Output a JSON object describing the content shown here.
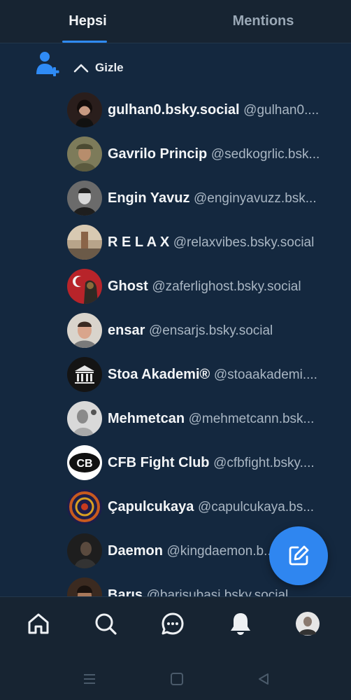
{
  "tabs": [
    {
      "label": "Hepsi",
      "active": true
    },
    {
      "label": "Mentions",
      "active": false
    }
  ],
  "toggle": {
    "label": "Gizle",
    "icon": "chevron-up-icon",
    "add_icon": "add-person-icon"
  },
  "users": [
    {
      "name": "gulhan0.bsky.social",
      "handle": "@gulhan0....",
      "avatar_color": "#3a2a26"
    },
    {
      "name": "Gavrilo Princip",
      "handle": "@sedkogrlic.bsk...",
      "avatar_color": "#6b6a4a"
    },
    {
      "name": "Engin Yavuz",
      "handle": "@enginyavuzz.bsk...",
      "avatar_color": "#555555"
    },
    {
      "name": "R E L A X",
      "handle": "@relaxvibes.bsky.social",
      "avatar_color": "#9a7a5c"
    },
    {
      "name": "Ghost",
      "handle": "@zaferlighost.bsky.social",
      "avatar_color": "#b8242a"
    },
    {
      "name": "ensar",
      "handle": "@ensarjs.bsky.social",
      "avatar_color": "#c9c2b8"
    },
    {
      "name": "Stoa Akademi®",
      "handle": "@stoaakademi....",
      "avatar_color": "#1b1b1b"
    },
    {
      "name": "Mehmetcan",
      "handle": "@mehmetcann.bsk...",
      "avatar_color": "#cfcfcf"
    },
    {
      "name": "CFB Fight Club",
      "handle": "@cfbfight.bsky....",
      "avatar_color": "#ffffff"
    },
    {
      "name": "Çapulcukaya",
      "handle": "@capulcukaya.bs...",
      "avatar_color": "#c85a1e"
    },
    {
      "name": "Daemon",
      "handle": "@kingdaemon.b...",
      "avatar_color": "#2b2b2b"
    },
    {
      "name": "Barış",
      "handle": "@barisubasi.bsky.social",
      "avatar_color": "#3b2a20"
    }
  ],
  "fab": {
    "icon": "compose-icon",
    "color": "#2f86f0"
  },
  "nav": [
    {
      "name": "home",
      "icon": "home-icon"
    },
    {
      "name": "search",
      "icon": "search-icon"
    },
    {
      "name": "chat",
      "icon": "chat-icon"
    },
    {
      "name": "notifications",
      "icon": "bell-icon",
      "active": true
    },
    {
      "name": "profile",
      "icon": "avatar"
    }
  ],
  "system_nav": [
    "menu-icon",
    "home-square-icon",
    "back-triangle-icon"
  ],
  "colors": {
    "accent": "#2f8bf5",
    "background": "#14283f",
    "bar": "#172432"
  }
}
